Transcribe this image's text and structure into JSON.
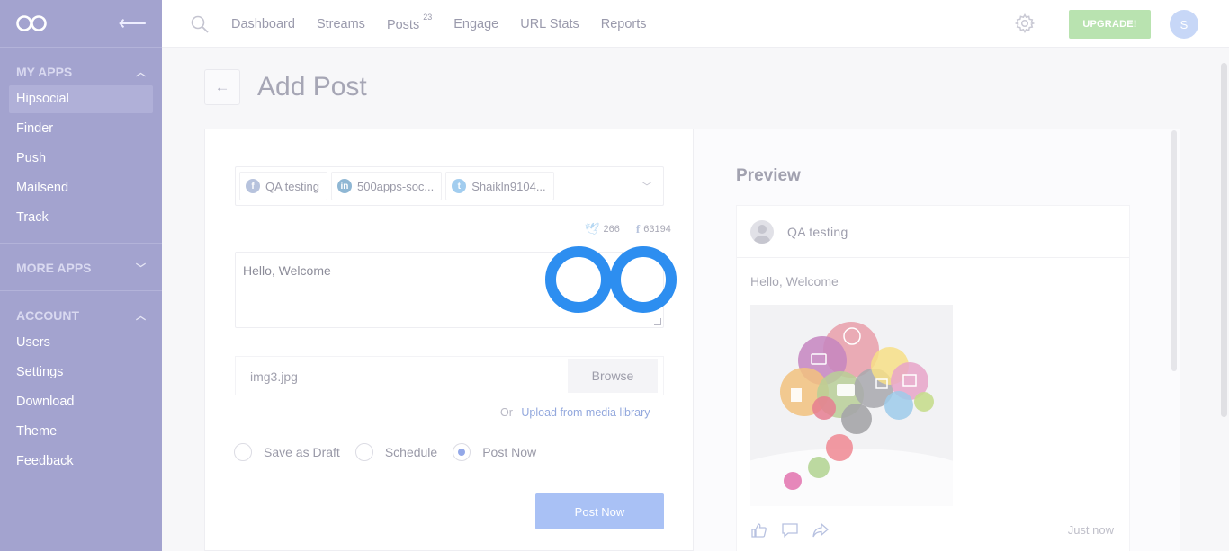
{
  "sidebar": {
    "sections": [
      {
        "title": "MY APPS",
        "items": [
          "Hipsocial",
          "Finder",
          "Push",
          "Mailsend",
          "Track"
        ]
      },
      {
        "title": "MORE APPS",
        "items": []
      },
      {
        "title": "ACCOUNT",
        "items": [
          "Users",
          "Settings",
          "Download",
          "Theme",
          "Feedback"
        ]
      }
    ],
    "active_item": "Hipsocial"
  },
  "nav": {
    "links": [
      "Dashboard",
      "Streams",
      "Posts",
      "Engage",
      "URL Stats",
      "Reports"
    ],
    "posts_badge": "23",
    "upgrade_label": "UPGRADE!",
    "avatar_initial": "S"
  },
  "page": {
    "title": "Add Post"
  },
  "editor": {
    "accounts": [
      {
        "network": "facebook",
        "label": "QA testing"
      },
      {
        "network": "linkedin",
        "label": "500apps-soc..."
      },
      {
        "network": "twitter",
        "label": "Shaikln9104..."
      }
    ],
    "twitter_count": "266",
    "facebook_count": "63194",
    "message": "Hello, Welcome",
    "file_name": "img3.jpg",
    "browse_label": "Browse",
    "or_label": "Or",
    "media_link": "Upload from media library",
    "options": [
      "Save as Draft",
      "Schedule",
      "Post Now"
    ],
    "selected_option": "Post Now",
    "submit_label": "Post Now"
  },
  "preview": {
    "title": "Preview",
    "account_name": "QA testing",
    "message": "Hello, Welcome",
    "timestamp": "Just now"
  },
  "colors": {
    "sidebar": "#a3a3cf",
    "accent": "#a9c1f5",
    "upgrade": "#b9e3b0",
    "logo_blue": "#2d8ef0"
  }
}
